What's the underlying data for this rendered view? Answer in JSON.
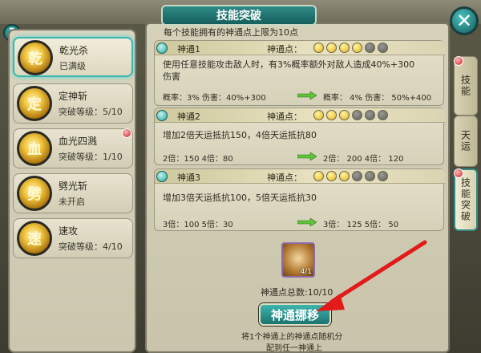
{
  "title": "技能突破",
  "limit_text": "每个技能拥有的神通点上限为10点",
  "help_label": "?",
  "close_label": "✕",
  "skills": [
    {
      "name": "乾光杀",
      "status": "已满级",
      "glyph": "乾",
      "selected": true
    },
    {
      "name": "定神斩",
      "status": "突破等级：5/10",
      "glyph": "定"
    },
    {
      "name": "血光四溅",
      "status": "突破等级：1/10",
      "glyph": "血"
    },
    {
      "name": "劈光斩",
      "status": "未开启",
      "glyph": "劈"
    },
    {
      "name": "速攻",
      "status": "突破等级：4/10",
      "glyph": "速"
    }
  ],
  "blocks": [
    {
      "title": "神通1",
      "points_label": "神通点：",
      "dots": [
        1,
        1,
        1,
        1,
        0,
        0
      ],
      "desc_line1": "使用任意技能攻击敌人时，有3%概率额外对敌人造成40%+300",
      "desc_line2": "伤害",
      "stats_left": "概率：3%   伤害：40%+300",
      "stats_right": "概率：   4%   伤害：   50%+400"
    },
    {
      "title": "神通2",
      "points_label": "神通点：",
      "dots": [
        1,
        1,
        1,
        0,
        0,
        0
      ],
      "desc_line1": "增加2倍天运抵抗150，4倍天运抵抗80",
      "stats_left": "2倍：150   4倍：80",
      "stats_right": "2倍：   200   4倍：   120"
    },
    {
      "title": "神通3",
      "points_label": "神通点：",
      "dots": [
        1,
        1,
        1,
        0,
        0,
        0
      ],
      "desc_line1": "增加3倍天运抵抗100，5倍天运抵抗30",
      "stats_left": "3倍：100   5倍：30",
      "stats_right": "3倍：   125   5倍：   50"
    }
  ],
  "item_count": "4/1",
  "total_points": "神通点总数:10/10",
  "move_button": "神通挪移",
  "tip_line1": "将1个神通上的神通点随机分",
  "tip_line2": "配到任一神通上",
  "tabs": [
    {
      "label": "技能"
    },
    {
      "label": "天运"
    },
    {
      "label": "技能突破",
      "active": true
    }
  ],
  "colors": {
    "accent": "#2f8a86",
    "gold_dot": "#e4b312",
    "red_badge": "#d1141a",
    "arrow_red": "#e21a1a",
    "arrow_green": "#5fc43a"
  }
}
